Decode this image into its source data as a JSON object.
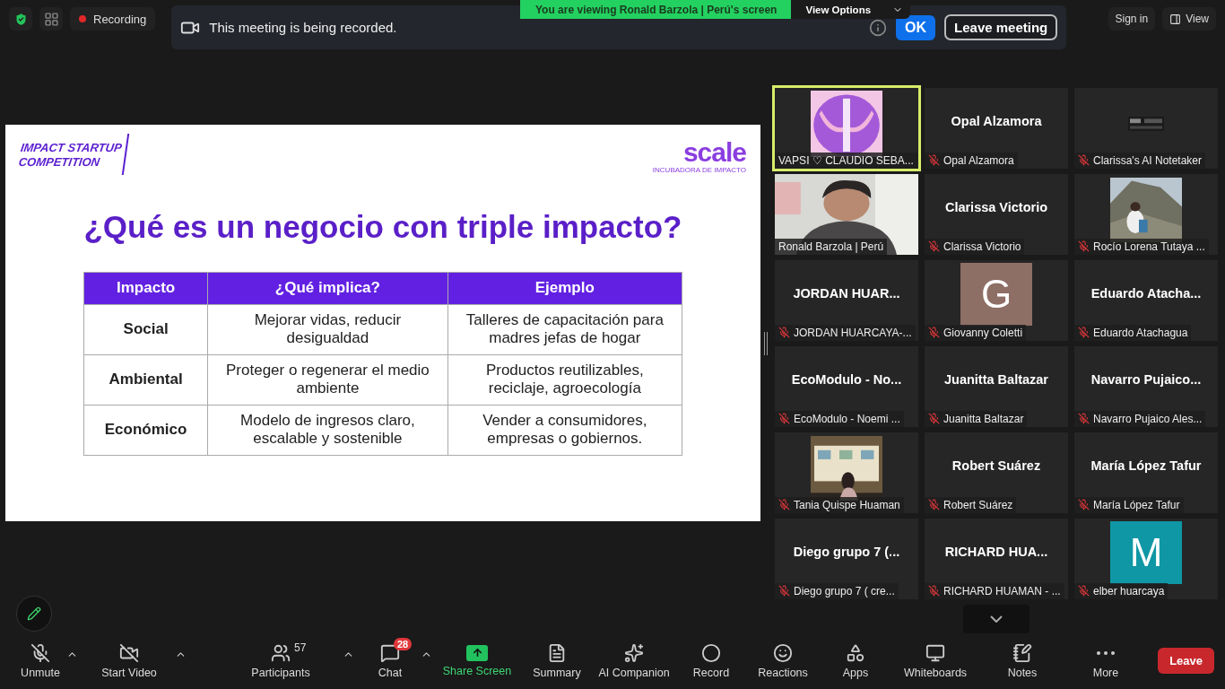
{
  "top_bar": {
    "recording_label": "Recording",
    "sign_in": "Sign in",
    "view": "View"
  },
  "recording_banner": {
    "message": "This meeting is being recorded.",
    "ok": "OK",
    "leave": "Leave meeting"
  },
  "share_notice": {
    "text": "You are viewing Ronald Barzola | Perú's screen",
    "view_options": "View Options"
  },
  "slide": {
    "brand_left": "IMPACT STARTUP",
    "brand_left_2": "COMPETITION",
    "brand_right": "scale",
    "brand_right_tagline": "INCUBADORA DE IMPACTO",
    "title": "¿Qué es un negocio con triple impacto?",
    "table": {
      "columns": [
        "Impacto",
        "¿Qué implica?",
        "Ejemplo"
      ],
      "rows": [
        [
          "Social",
          "Mejorar vidas, reducir desigualdad",
          "Talleres de capacitación para madres jefas de hogar"
        ],
        [
          "Ambiental",
          "Proteger o regenerar el medio ambiente",
          "Productos reutilizables, reciclaje, agroecología"
        ],
        [
          "Económico",
          "Modelo de ingresos claro, escalable y sostenible",
          "Vender a consumidores, empresas o gobiernos."
        ]
      ]
    }
  },
  "gallery": {
    "tiles": [
      {
        "kind": "picture",
        "label": "VAPSI ♡ CLAUDIO SEBA...",
        "muted": false,
        "selected": true
      },
      {
        "kind": "name",
        "name": "Opal Alzamora",
        "label": "Opal Alzamora",
        "muted": true,
        "selected": false
      },
      {
        "kind": "picture",
        "label": "Clarissa's AI Notetaker",
        "muted": true,
        "selected": false
      },
      {
        "kind": "picture",
        "label": "Ronald Barzola | Perú",
        "muted": false,
        "selected": false
      },
      {
        "kind": "name",
        "name": "Clarissa Victorio",
        "label": "Clarissa Victorio",
        "muted": true,
        "selected": false
      },
      {
        "kind": "picture",
        "label": "Rocío Lorena Tutaya ...",
        "muted": true,
        "selected": false
      },
      {
        "kind": "name",
        "name": "JORDAN  HUAR...",
        "label": "JORDAN HUARCAYA-...",
        "muted": true,
        "selected": false
      },
      {
        "kind": "avatar",
        "name": "G",
        "color": "#8e6f66",
        "label": "Giovanny Coletti",
        "muted": true,
        "selected": false
      },
      {
        "kind": "name",
        "name": "Eduardo  Atacha...",
        "label": "Eduardo Atachagua",
        "muted": true,
        "selected": false
      },
      {
        "kind": "name",
        "name": "EcoModulo  -  No...",
        "label": "EcoModulo - Noemi ...",
        "muted": true,
        "selected": false
      },
      {
        "kind": "name",
        "name": "Juanitta Baltazar",
        "label": "Juanitta Baltazar",
        "muted": true,
        "selected": false
      },
      {
        "kind": "name",
        "name": "Navarro  Pujaico...",
        "label": "Navarro Pujaico Ales...",
        "muted": true,
        "selected": false
      },
      {
        "kind": "picture",
        "label": "Tania Quispe Huaman",
        "muted": true,
        "selected": false
      },
      {
        "kind": "name",
        "name": "Robert Suárez",
        "label": "Robert Suárez",
        "muted": true,
        "selected": false
      },
      {
        "kind": "name",
        "name": "María López Tafur",
        "label": "María López Tafur",
        "muted": true,
        "selected": false
      },
      {
        "kind": "name",
        "name": "Diego  grupo  7  (...",
        "label": "Diego grupo 7 ( cre...",
        "muted": true,
        "selected": false
      },
      {
        "kind": "name",
        "name": "RICHARD  HUA...",
        "label": "RICHARD HUAMAN - ...",
        "muted": true,
        "selected": false
      },
      {
        "kind": "avatar",
        "name": "M",
        "color": "#0f97a5",
        "label": "elber huarcaya",
        "muted": true,
        "selected": false
      }
    ]
  },
  "toolbar": {
    "items": [
      {
        "kind": "mic",
        "label": "Unmute",
        "caret": true,
        "off": true
      },
      {
        "kind": "video",
        "label": "Start Video",
        "caret": true,
        "off": true
      },
      {
        "kind": "participants",
        "label": "Participants",
        "count": "57",
        "caret": true
      },
      {
        "kind": "chat",
        "label": "Chat",
        "badge": "28",
        "caret": true
      },
      {
        "kind": "share",
        "label": "Share Screen"
      },
      {
        "kind": "summary",
        "label": "Summary"
      },
      {
        "kind": "ai",
        "label": "AI Companion"
      },
      {
        "kind": "record",
        "label": "Record"
      },
      {
        "kind": "reactions",
        "label": "Reactions"
      },
      {
        "kind": "apps",
        "label": "Apps"
      },
      {
        "kind": "whiteboards",
        "label": "Whiteboards"
      },
      {
        "kind": "notes",
        "label": "Notes"
      },
      {
        "kind": "more",
        "label": "More"
      }
    ],
    "leave": "Leave"
  }
}
